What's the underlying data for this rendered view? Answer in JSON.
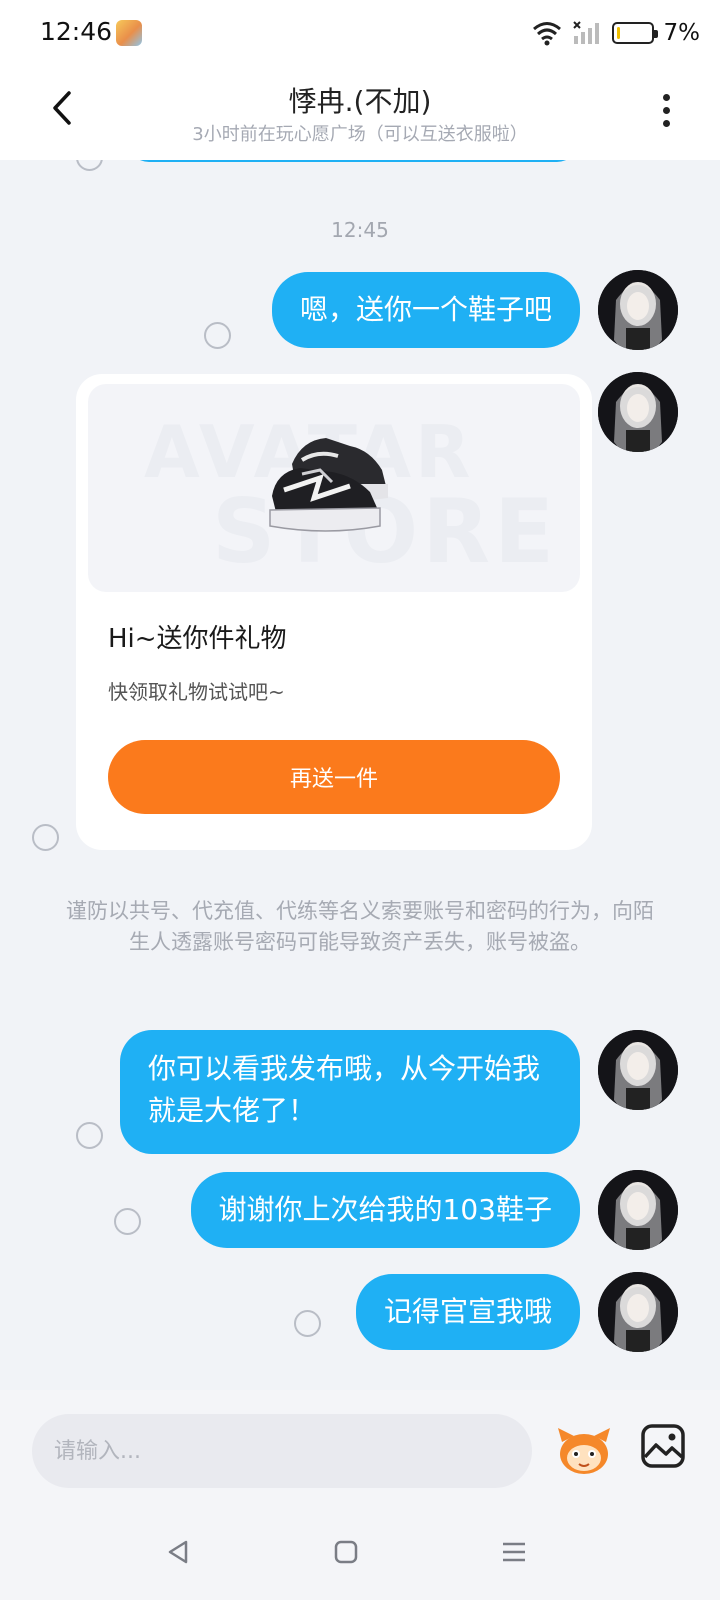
{
  "status_bar": {
    "time": "12:46",
    "battery": "7%",
    "battery_level": 0.07
  },
  "header": {
    "title": "悸冉.(不加)",
    "subtitle": "3小时前在玩心愿广场（可以互送衣服啦）"
  },
  "chat": {
    "timestamp": "12:45",
    "messages": [
      {
        "text": "嗯，送你一个鞋子吧"
      },
      {
        "text": "你可以看我发布哦，从今开始我就是大佬了！"
      },
      {
        "text": "谢谢你上次给我的103鞋子"
      },
      {
        "text": "记得官宣我哦"
      }
    ],
    "gift_card": {
      "watermark_line1": "AVATAR",
      "watermark_line2": "STORE",
      "title": "Hi~送你件礼物",
      "description": "快领取礼物试试吧~",
      "button_label": "再送一件"
    },
    "warning": "谨防以共号、代充值、代练等名义索要账号和密码的行为，向陌生人透露账号密码可能导致资产丢失，账号被盗。"
  },
  "input": {
    "placeholder": "请输入..."
  },
  "colors": {
    "bubble": "#1fb0f4",
    "gift_button": "#fb7a1c",
    "chat_background": "#f1f3f7"
  },
  "icons": {
    "back": "chevron-left-icon",
    "more": "more-vertical-icon",
    "emoji": "emoji-mascot-icon",
    "image": "image-icon",
    "nav_back": "triangle-back-icon",
    "nav_home": "square-home-icon",
    "nav_menu": "menu-lines-icon"
  }
}
